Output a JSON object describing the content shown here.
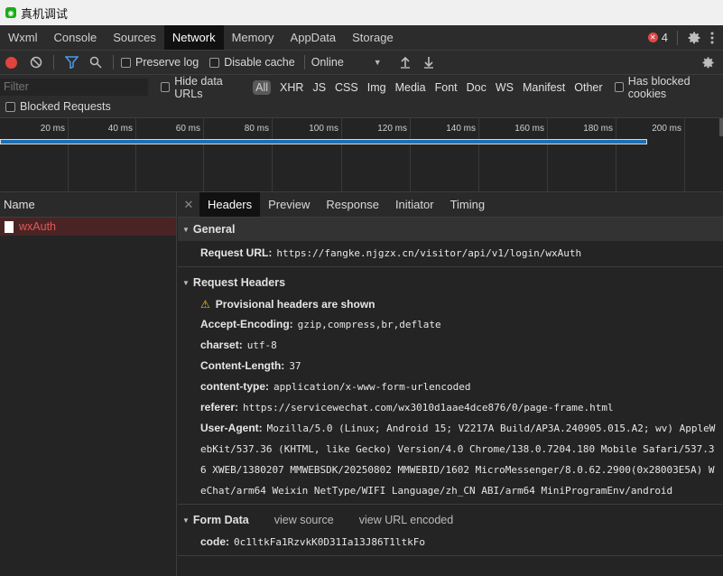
{
  "window": {
    "title": "真机调试"
  },
  "tabs": [
    {
      "label": "Wxml"
    },
    {
      "label": "Console"
    },
    {
      "label": "Sources"
    },
    {
      "label": "Network",
      "active": true
    },
    {
      "label": "Memory"
    },
    {
      "label": "AppData"
    },
    {
      "label": "Storage"
    }
  ],
  "errors": {
    "count": "4"
  },
  "toolbar": {
    "preserve_log": "Preserve log",
    "disable_cache": "Disable cache",
    "throttle": "Online"
  },
  "filter": {
    "placeholder": "Filter",
    "hide_data_urls": "Hide data URLs",
    "types": [
      "All",
      "XHR",
      "JS",
      "CSS",
      "Img",
      "Media",
      "Font",
      "Doc",
      "WS",
      "Manifest",
      "Other"
    ],
    "has_blocked_cookies": "Has blocked cookies",
    "blocked_requests": "Blocked Requests"
  },
  "timeline": {
    "ticks": [
      "20 ms",
      "40 ms",
      "60 ms",
      "80 ms",
      "100 ms",
      "120 ms",
      "140 ms",
      "160 ms",
      "180 ms",
      "200 ms"
    ]
  },
  "requests": {
    "header": "Name",
    "items": [
      {
        "name": "wxAuth",
        "failed": true
      }
    ]
  },
  "details": {
    "tabs": [
      "Headers",
      "Preview",
      "Response",
      "Initiator",
      "Timing"
    ],
    "general": {
      "title": "General",
      "request_url_key": "Request URL:",
      "request_url": "https://fangke.njgzx.cn/visitor/api/v1/login/wxAuth"
    },
    "request_headers": {
      "title": "Request Headers",
      "provisional": "Provisional headers are shown",
      "items": [
        {
          "key": "Accept-Encoding:",
          "value": "gzip,compress,br,deflate"
        },
        {
          "key": "charset:",
          "value": "utf-8"
        },
        {
          "key": "Content-Length:",
          "value": "37"
        },
        {
          "key": "content-type:",
          "value": "application/x-www-form-urlencoded"
        },
        {
          "key": "referer:",
          "value": "https://servicewechat.com/wx3010d1aae4dce876/0/page-frame.html"
        },
        {
          "key": "User-Agent:",
          "value": "Mozilla/5.0 (Linux; Android 15; V2217A Build/AP3A.240905.015.A2; wv) AppleWebKit/537.36 (KHTML, like Gecko) Version/4.0 Chrome/138.0.7204.180 Mobile Safari/537.36 XWEB/1380207 MMWEBSDK/20250802 MMWEBID/1602 MicroMessenger/8.0.62.2900(0x28003E5A) WeChat/arm64 Weixin NetType/WIFI Language/zh_CN ABI/arm64 MiniProgramEnv/android"
        }
      ]
    },
    "form_data": {
      "title": "Form Data",
      "view_source": "view source",
      "view_url_encoded": "view URL encoded",
      "items": [
        {
          "key": "code:",
          "value": "0c1ltkFa1RzvkK0D31Ia13J86T1ltkFo"
        }
      ]
    }
  }
}
